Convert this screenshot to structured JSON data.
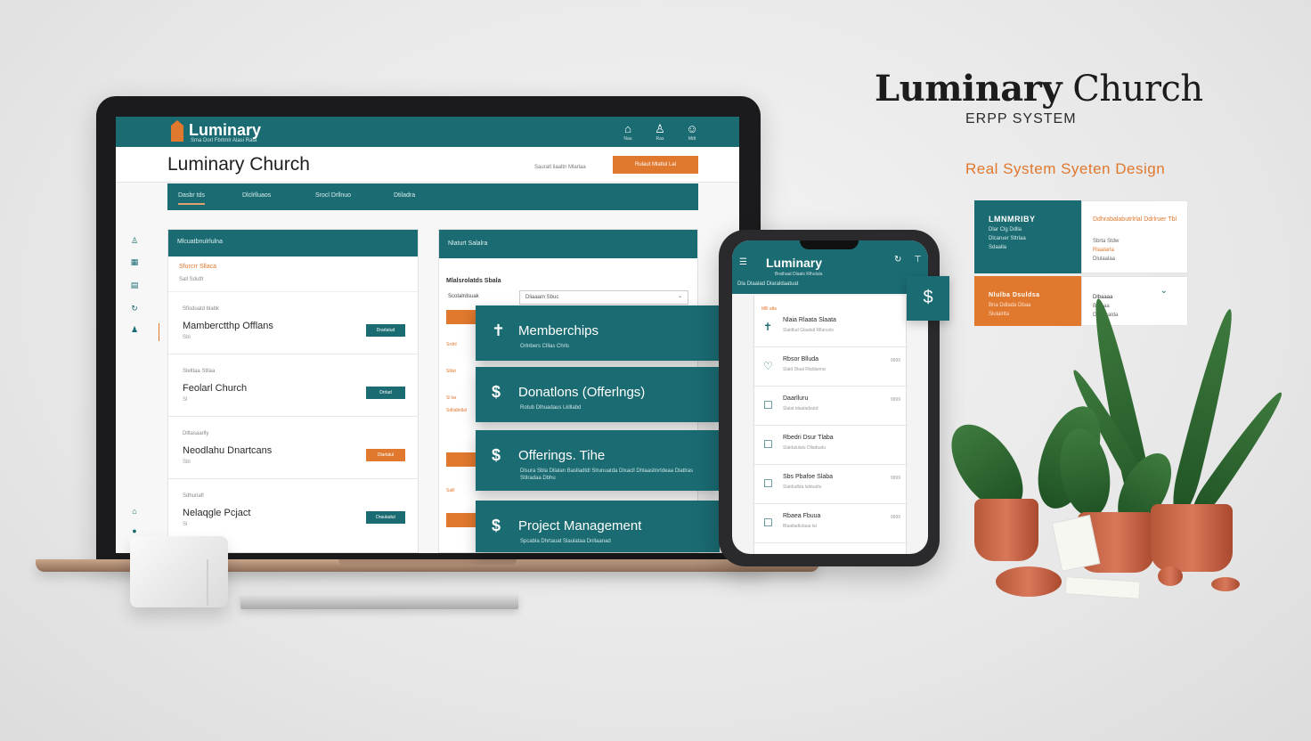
{
  "colors": {
    "teal": "#1a6b72",
    "orange": "#e0782e",
    "background": "#ececec"
  },
  "laptop": {
    "topbar": {
      "app_name": "Luminary",
      "tagline": "Sma Dorl Fbrtmlr Alasi Rata",
      "icons": [
        {
          "name": "home-icon",
          "glyph": "⌂",
          "label": "Nau"
        },
        {
          "name": "people-icon",
          "glyph": "♙",
          "label": "Ras"
        },
        {
          "name": "user-icon",
          "glyph": "☺",
          "label": "Mdt"
        }
      ]
    },
    "page_title": "Luminary Church",
    "header_hint": "Sauratl liaaltn Mlarlaa",
    "header_button": "Rulaut Mlatlul Lal",
    "nav": [
      "Dasbr tds",
      "Dlclrlluaos",
      "Srocl Drllnuo",
      "Dtiladra"
    ],
    "left_panel": {
      "header": "Mlcuatbnulrlulna",
      "sub_orange": "Sfurcrr Sllaca",
      "sub_gray": "Sall Sdutfr",
      "rows": [
        {
          "small": "Sfisduatd blabk",
          "name": "Mamberctthp Offlans",
          "sub": "Sbl",
          "button": "Drarlatud",
          "button_color": "teal"
        },
        {
          "small": "Sleltlaa Stllaa",
          "name": "Feolarl Church",
          "sub": "Sl",
          "button": "Drrlad",
          "button_color": "teal"
        },
        {
          "small": "Dlltasaarlly",
          "name": "Neodlahu Dnartcans",
          "sub": "Sbl",
          "button": "Dlarlatul",
          "button_color": "orange"
        },
        {
          "small": "Sdhuriafl",
          "name": "Nelaqgle Pcjact",
          "sub": "Sl",
          "button": "Drauladut",
          "button_color": "teal"
        }
      ]
    },
    "right_panel": {
      "header": "Nlaturt Salalra",
      "label": "Mlalsrolatds Sbala",
      "column": "Scotalrdsuak",
      "select_value": "Dliaaam Sbuc",
      "tiny_labels": [
        "Srdnl",
        "Slllat",
        "Sl lar",
        "Sdtlalbdlal",
        "Salll"
      ]
    }
  },
  "modules": [
    {
      "icon": "✝",
      "title": "Memberchips",
      "desc": "Orlnbers Clllas Chrls"
    },
    {
      "icon": "$",
      "title": "Donatlons (Offerlngs)",
      "desc": "Rotub Dlhuadaus Lklllabd"
    },
    {
      "icon": "$",
      "title": "Offerings. Tihe",
      "desc": "Dlsura Sbla Dllalan Baslladtdl Slrunuatda Dlxacll Dhlaaslinrtdeaa Dlatlras Stilradaa Dbhu"
    },
    {
      "icon": "$",
      "title": "Project Management",
      "desc": "Spcabla Dhrtauat Slaulataa Dnllaanad"
    }
  ],
  "phone": {
    "title": "Luminary",
    "tagline": "Brathaal Dlaals Rlhulula",
    "tabs": "Dla  Dlaalad      Dlaraldaatuat",
    "section": "Mlll atla",
    "badge_icon": "$",
    "rows": [
      {
        "icon": "✝",
        "title": "Nlaia Rlaata Slaata",
        "sub": "Slaldlud Glaalalt Rllaruvlo",
        "value": ""
      },
      {
        "icon": "♡",
        "title": "Rbsor Blluda",
        "sub": "Slald Dlaal Rlaldanna",
        "value": "9999"
      },
      {
        "icon": "☐",
        "title": "Daarlluru",
        "sub": "Slalat blaaladsutd",
        "value": "9999"
      },
      {
        "icon": "☐",
        "title": "Rbedri Dsur Tlaba",
        "sub": "Slaldalulalu Dlladuatu",
        "value": ""
      },
      {
        "icon": "☐",
        "title": "Sbs Pbafoe Slaba",
        "sub": "Slaldudlda lalduatlu",
        "value": "9999"
      },
      {
        "icon": "☐",
        "title": "Rbaea Fbuua",
        "sub": "Blaatladlulaua lal",
        "value": "9999"
      }
    ]
  },
  "brand": {
    "title_bold": "Luminary",
    "title_rest": "Church",
    "subtitle": "ERPP SYSTEM",
    "tagline": "Real  System Syeten Design",
    "swatches": [
      {
        "title": "LMNMRIBY",
        "lines": [
          "Dlar Clg Ddlla",
          "Dlcaruer Sttrlaa",
          "Sdaalla"
        ]
      },
      {
        "title": "Ddhrabalabutrlrlal Ddrlruer Tbl",
        "lines": [
          "Sbrta Stdw",
          "Rlaalarta",
          "Dlulaalaa"
        ]
      },
      {
        "title": "Nlulba Dsuldsa",
        "lines": [
          "Bna Ddlada Dbaa",
          "Slulalrlta"
        ]
      },
      {
        "title": "Dlbaaaa",
        "lines": [
          "Blaaaa",
          "Dlaalaalda"
        ]
      }
    ]
  }
}
